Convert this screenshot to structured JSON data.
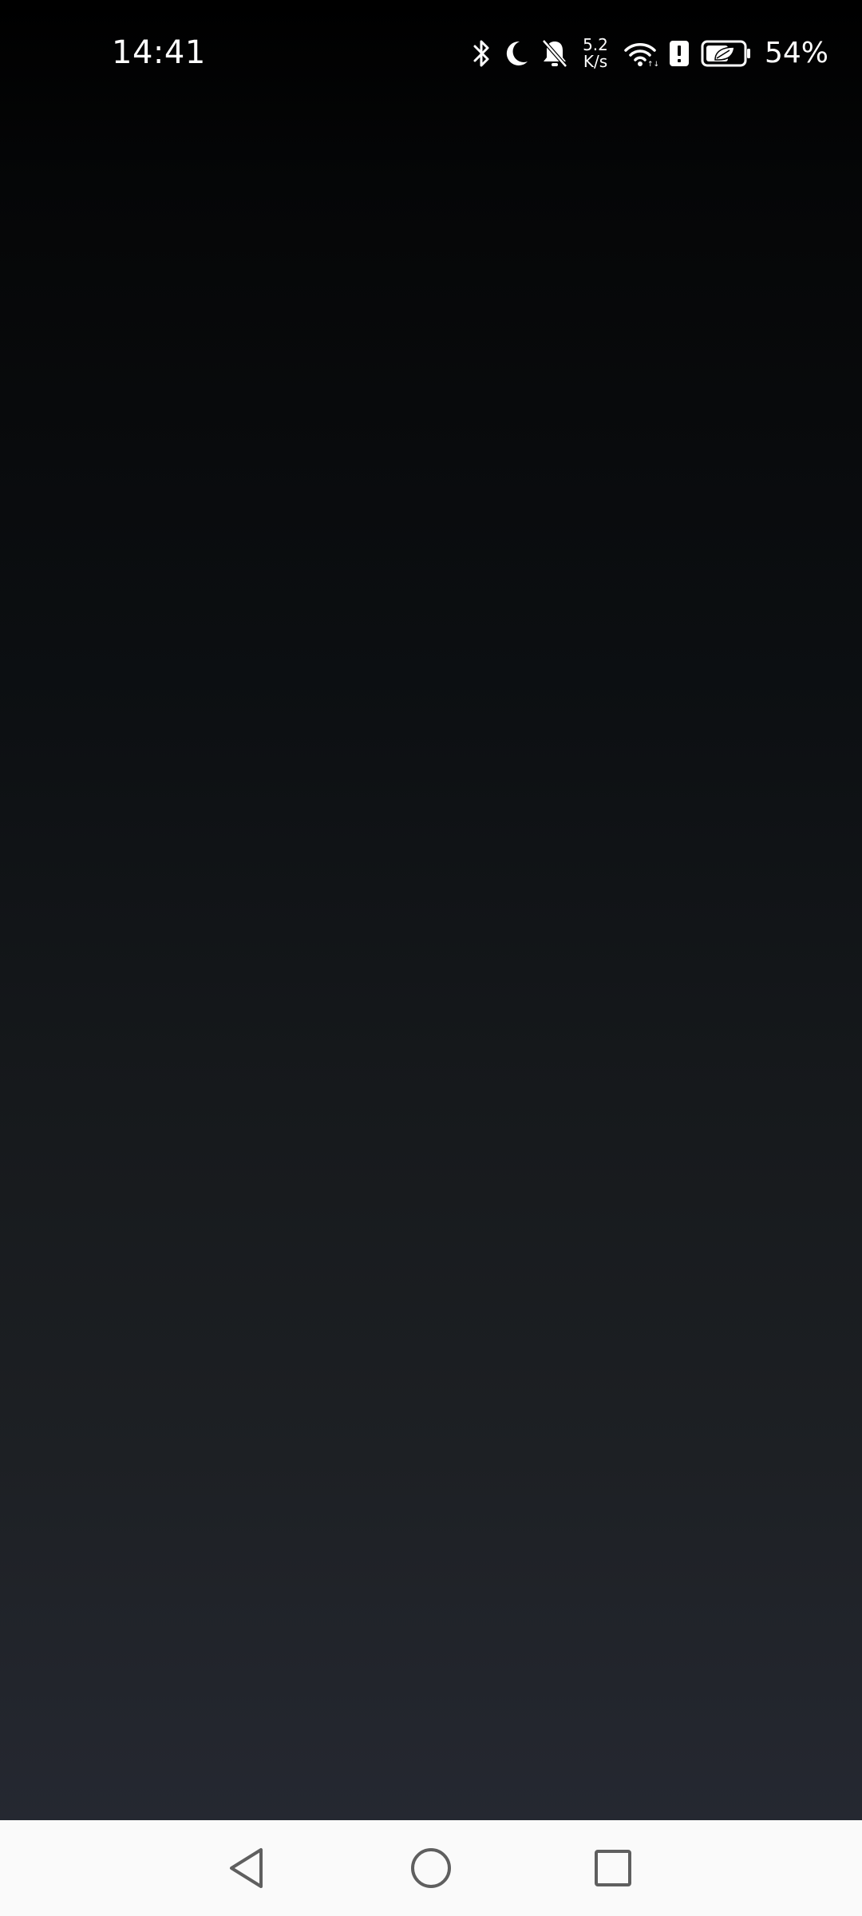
{
  "status_bar": {
    "time": "14:41",
    "net_speed_value": "5.2",
    "net_speed_unit": "K/s",
    "battery_percent": "54%",
    "icons": [
      "bluetooth-icon",
      "moon-icon",
      "bell-off-icon",
      "wifi-icon",
      "alert-icon",
      "battery-saver-icon"
    ]
  },
  "nav_bar": {
    "buttons": [
      "back-button",
      "home-button",
      "recents-button"
    ]
  },
  "colors": {
    "background_top": "#000000",
    "background_bottom": "#252831",
    "status_text": "#ffffff",
    "nav_background": "#fafafa",
    "nav_icon": "#5f5f5f"
  }
}
